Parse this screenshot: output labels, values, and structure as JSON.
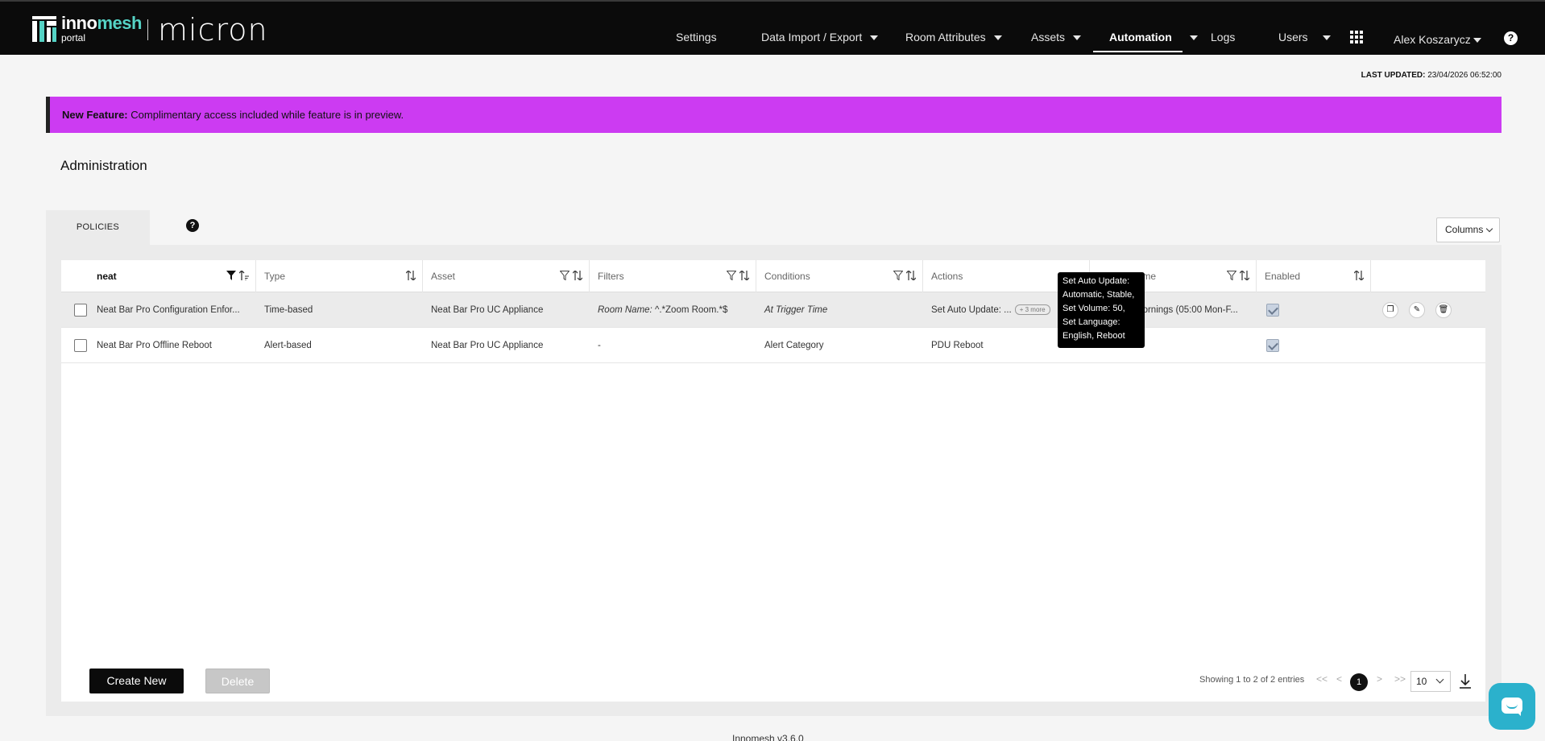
{
  "header": {
    "logo_brand_a": "inno",
    "logo_brand_b": "mesh",
    "logo_sub": "portal",
    "product": "micron",
    "nav": [
      {
        "label": "Settings",
        "has_caret": false
      },
      {
        "label": "Data Import / Export",
        "has_caret": true
      },
      {
        "label": "Room Attributes",
        "has_caret": true
      },
      {
        "label": "Assets",
        "has_caret": true
      },
      {
        "label": "Automation",
        "has_caret": true,
        "active": true
      },
      {
        "label": "Logs",
        "has_caret": false
      },
      {
        "label": "Users",
        "has_caret": true
      }
    ],
    "user": "Alex Koszarycz",
    "help": "?"
  },
  "last_updated": {
    "label": "LAST UPDATED:",
    "value": "23/04/2026 06:52:00"
  },
  "banner": {
    "bold": "New Feature:",
    "text": "Complimentary access included while feature is in preview."
  },
  "page_title": "Administration",
  "tabs": {
    "policies": "POLICIES",
    "help": "?"
  },
  "columns_button": "Columns",
  "table": {
    "columns": [
      "neat",
      "Type",
      "Asset",
      "Filters",
      "Conditions",
      "Actions",
      "Name",
      "Enabled"
    ],
    "rows": [
      {
        "name": "Neat Bar Pro Configuration Enfor...",
        "type": "Time-based",
        "asset": "Neat Bar Pro UC Appliance",
        "filters_label": "Room Name:",
        "filters_value": "^.*Zoom Room.*$",
        "conditions": "At Trigger Time",
        "actions": "Set Auto Update: ...",
        "actions_more": "+ 3 more",
        "schedule": "mornings (05:00 Mon-F...",
        "enabled": true
      },
      {
        "name": "Neat Bar Pro Offline Reboot",
        "type": "Alert-based",
        "asset": "Neat Bar Pro UC Appliance",
        "filters_label": "-",
        "filters_value": "",
        "conditions": "Alert Category",
        "actions": "PDU Reboot",
        "actions_more": "",
        "schedule": "",
        "enabled": true
      }
    ]
  },
  "tooltip": [
    "Set Auto Update:",
    "Automatic, Stable,",
    "Set Volume: 50,",
    "Set Language:",
    "English, Reboot"
  ],
  "buttons": {
    "create": "Create New",
    "delete": "Delete"
  },
  "pagination": {
    "summary": "Showing 1 to 2 of 2 entries",
    "first": "<<",
    "prev": "<",
    "current": "1",
    "next": ">",
    "last": ">>",
    "page_size": "10"
  },
  "footer": "Innomesh v3.6.0"
}
